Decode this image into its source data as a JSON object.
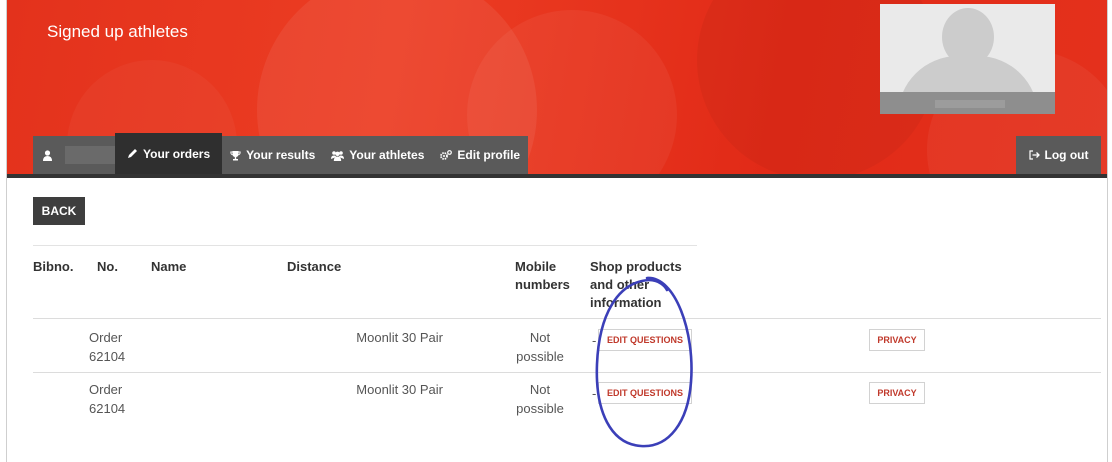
{
  "banner": {
    "title": "Signed up athletes",
    "color": "#e3321c"
  },
  "nav": {
    "items": [
      {
        "label": "Your orders",
        "icon": "pencil-icon",
        "active": true
      },
      {
        "label": "Your results",
        "icon": "trophy-icon"
      },
      {
        "label": "Your athletes",
        "icon": "users-icon"
      },
      {
        "label": "Edit profile",
        "icon": "gears-icon"
      }
    ],
    "logout_label": "Log out"
  },
  "back_label": "BACK",
  "table": {
    "headers": {
      "bibno": "Bibno.",
      "no": "No.",
      "name": "Name",
      "distance": "Distance",
      "mobile_1": "Mobile",
      "mobile_2": "numbers",
      "shop_1": "Shop products",
      "shop_2": "and other",
      "shop_3": "information"
    },
    "rows": [
      {
        "order_1": "Order",
        "order_2": "62104",
        "distance": "Moonlit 30 Pair",
        "mobile_1": "Not",
        "mobile_2": "possible",
        "shop_prefix": "-",
        "edit_label": "EDIT QUESTIONS",
        "privacy_label": "PRIVACY"
      },
      {
        "order_1": "Order",
        "order_2": "62104",
        "distance": "Moonlit 30 Pair",
        "mobile_1": "Not",
        "mobile_2": "possible",
        "shop_prefix": "-",
        "edit_label": "EDIT QUESTIONS",
        "privacy_label": "PRIVACY"
      }
    ]
  },
  "annotation_color": "#3b3fb8"
}
